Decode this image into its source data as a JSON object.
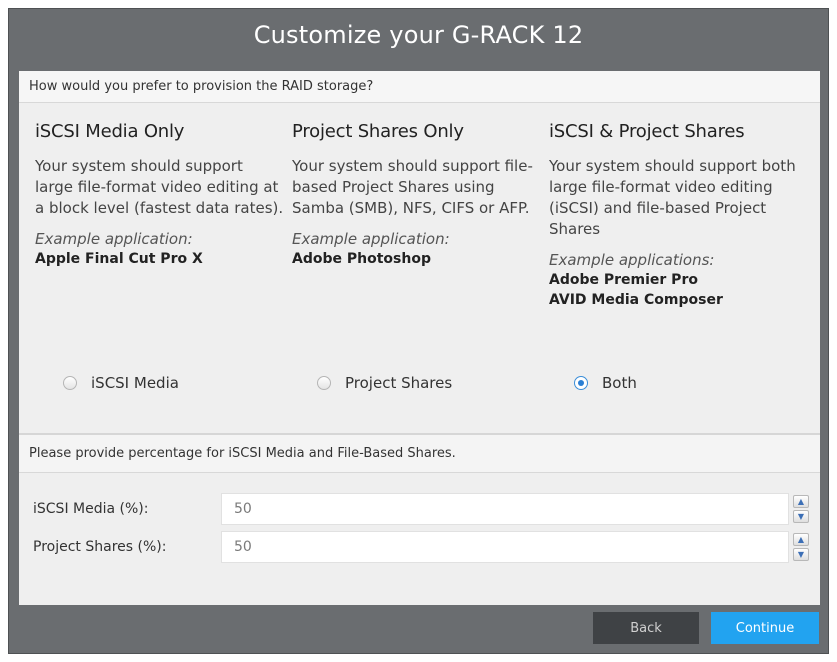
{
  "dialog": {
    "title": "Customize your G-RACK 12"
  },
  "raid": {
    "question": "How would you prefer to provision the RAID storage?",
    "options": [
      {
        "heading": "iSCSI Media Only",
        "description": "Your system should support large file-format video editing at a block level (fastest data rates).",
        "example_label": "Example application:",
        "example_apps": [
          "Apple Final Cut Pro X"
        ],
        "radio_label": "iSCSI Media",
        "selected": false
      },
      {
        "heading": "Project Shares Only",
        "description": "Your system should support file-based Project Shares using Samba (SMB), NFS, CIFS or AFP.",
        "example_label": "Example application:",
        "example_apps": [
          "Adobe Photoshop"
        ],
        "radio_label": "Project Shares",
        "selected": false
      },
      {
        "heading": "iSCSI & Project Shares",
        "description": "Your system should support both large file-format video editing (iSCSI) and file-based Project Shares",
        "example_label": "Example applications:",
        "example_apps": [
          "Adobe Premier Pro",
          "AVID Media Composer"
        ],
        "radio_label": "Both",
        "selected": true
      }
    ]
  },
  "percentage": {
    "question": "Please provide percentage for iSCSI Media and File-Based Shares.",
    "fields": [
      {
        "label": "iSCSI Media (%):",
        "value": "50"
      },
      {
        "label": "Project Shares (%):",
        "value": "50"
      }
    ]
  },
  "icons": {
    "stepper_up": "chevron-up-icon",
    "stepper_down": "chevron-down-icon"
  },
  "footer": {
    "back_label": "Back",
    "continue_label": "Continue"
  },
  "colors": {
    "frame": "#6a6d70",
    "panel": "#efefef",
    "back_button": "#3f4245",
    "continue_button": "#22a3f0",
    "radio_selected": "#2a7fd4"
  }
}
